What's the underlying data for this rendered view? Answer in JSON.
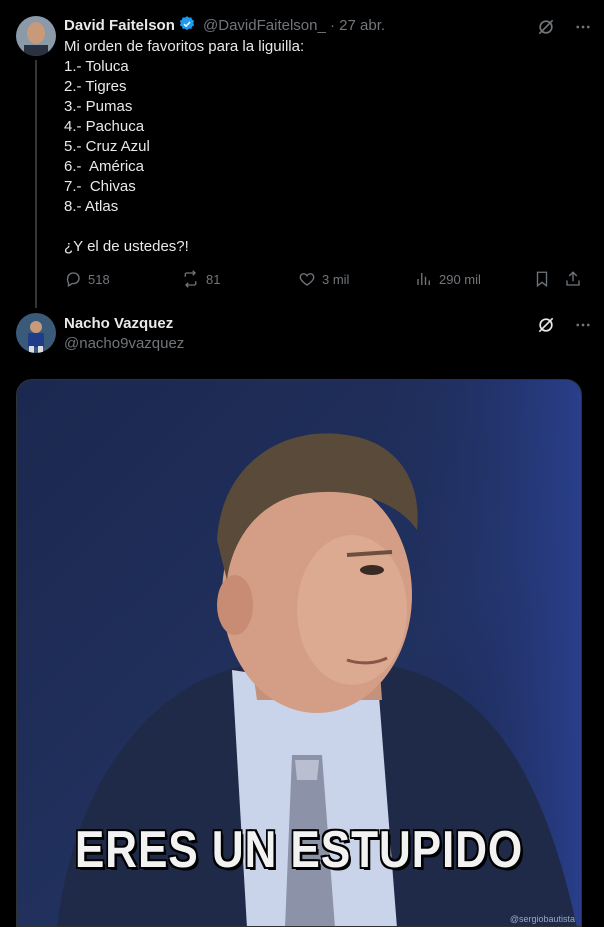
{
  "tweet1": {
    "display_name": "David Faitelson",
    "handle": "@DavidFaitelson_",
    "separator": "·",
    "date": "27 abr.",
    "lines": [
      "Mi orden de favoritos para la liguilla:",
      "1.- Toluca",
      "2.- Tigres",
      "3.- Pumas",
      "4.- Pachuca",
      "5.- Cruz Azul",
      "6.-  América",
      "7.-  Chivas",
      "8.- Atlas",
      "",
      "¿Y el de ustedes?!"
    ],
    "replies": "518",
    "retweets": "81",
    "likes": "3 mil",
    "views": "290 mil",
    "accent": "#1d9bf0"
  },
  "tweet2": {
    "display_name": "Nacho Vazquez",
    "handle": "@nacho9vazquez",
    "media_caption": "ERES UN ESTUPIDO",
    "watermark": "@sergiobautista"
  }
}
